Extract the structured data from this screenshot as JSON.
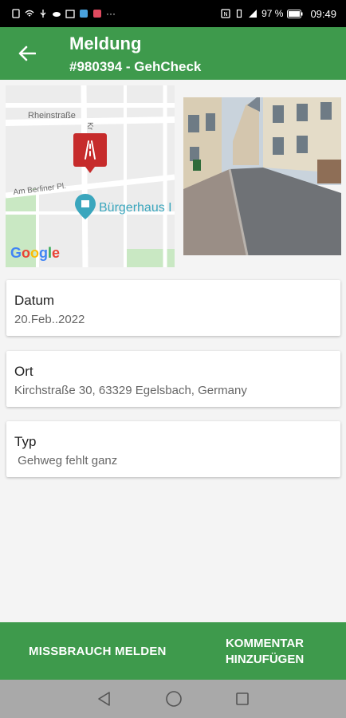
{
  "status": {
    "battery": "97 %",
    "time": "09:49"
  },
  "header": {
    "title": "Meldung",
    "subtitle": "#980394 - GehCheck"
  },
  "map": {
    "streets": [
      "Rheinstraße",
      "Am Berliner Pl.",
      "Kr"
    ],
    "poi": "Bürgerhaus I",
    "logo": "Google"
  },
  "cards": [
    {
      "label": "Datum",
      "value": "20.Feb..2022"
    },
    {
      "label": "Ort",
      "value": "Kirchstraße 30, 63329 Egelsbach, Germany"
    },
    {
      "label": "Typ",
      "value": " Gehweg fehlt ganz"
    }
  ],
  "actions": {
    "report_abuse": "MISSBRAUCH MELDEN",
    "add_comment": "KOMMENTAR HINZUFÜGEN"
  },
  "colors": {
    "primary": "#3e9a4c",
    "marker": "#c62b2b",
    "poi": "#3aa6bd"
  }
}
